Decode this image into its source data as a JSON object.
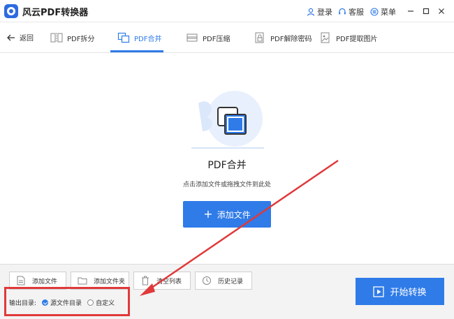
{
  "app": {
    "title": "风云PDF转换器",
    "login": "登录",
    "service": "客服",
    "menu": "菜单"
  },
  "nav": {
    "back": "返回",
    "tabs": [
      {
        "label": "PDF拆分",
        "icon": "split-icon"
      },
      {
        "label": "PDF合并",
        "icon": "merge-icon",
        "active": true
      },
      {
        "label": "PDF压缩",
        "icon": "compress-icon"
      },
      {
        "label": "PDF解除密码",
        "icon": "unlock-icon"
      },
      {
        "label": "PDF提取图片",
        "icon": "extract-image-icon"
      }
    ]
  },
  "main": {
    "title": "PDF合并",
    "subtitle": "点击添加文件或拖拽文件到此处",
    "add_file_button": "添加文件"
  },
  "toolbar": {
    "add_file": "添加文件",
    "add_folder": "添加文件夹",
    "clear_list": "清空列表",
    "history": "历史记录"
  },
  "output": {
    "label": "输出目录:",
    "options": [
      "源文件目录",
      "自定义"
    ],
    "selected": "源文件目录"
  },
  "start_button": "开始转换",
  "colors": {
    "accent": "#2f7be8",
    "annotation": "#e0393a"
  }
}
